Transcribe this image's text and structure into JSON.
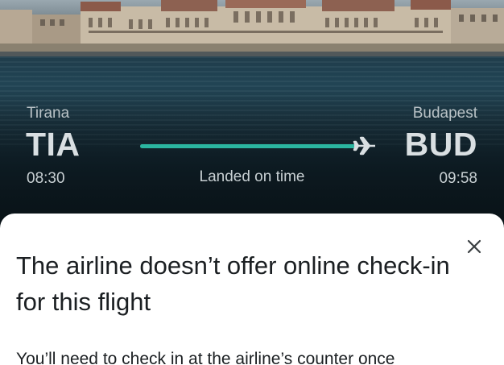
{
  "flight": {
    "origin": {
      "city": "Tirana",
      "code": "TIA",
      "time": "08:30"
    },
    "destination": {
      "city": "Budapest",
      "code": "BUD",
      "time": "09:58"
    },
    "status": "Landed on time",
    "progress_fraction": 1.0,
    "progress_color": "#2bb5a0"
  },
  "sheet": {
    "title": "The airline doesn’t offer online check-in for this flight",
    "body": "You’ll need to check in at the airline’s counter once",
    "close_icon": "close-icon"
  },
  "hero": {
    "image_subject": "parliament-building-icon"
  }
}
